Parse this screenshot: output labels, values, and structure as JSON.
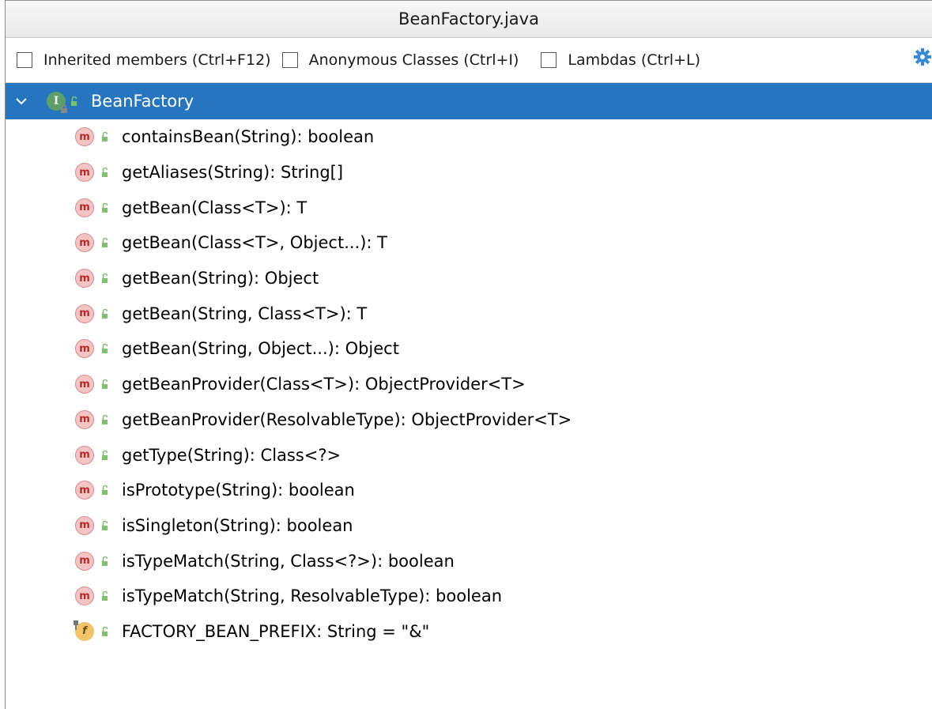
{
  "window": {
    "title": "BeanFactory.java"
  },
  "options": {
    "inherited": "Inherited members (Ctrl+F12)",
    "anonymous": "Anonymous Classes (Ctrl+I)",
    "lambdas": "Lambdas (Ctrl+L)"
  },
  "tree": {
    "root": {
      "label": "BeanFactory",
      "icon_letter": "I",
      "selected": true
    },
    "members": [
      {
        "kind": "m",
        "label": "containsBean(String): boolean"
      },
      {
        "kind": "m",
        "label": "getAliases(String): String[]"
      },
      {
        "kind": "m",
        "label": "getBean(Class<T>): T"
      },
      {
        "kind": "m",
        "label": "getBean(Class<T>, Object...): T"
      },
      {
        "kind": "m",
        "label": "getBean(String): Object"
      },
      {
        "kind": "m",
        "label": "getBean(String, Class<T>): T"
      },
      {
        "kind": "m",
        "label": "getBean(String, Object...): Object"
      },
      {
        "kind": "m",
        "label": "getBeanProvider(Class<T>): ObjectProvider<T>"
      },
      {
        "kind": "m",
        "label": "getBeanProvider(ResolvableType): ObjectProvider<T>"
      },
      {
        "kind": "m",
        "label": "getType(String): Class<?>"
      },
      {
        "kind": "m",
        "label": "isPrototype(String): boolean"
      },
      {
        "kind": "m",
        "label": "isSingleton(String): boolean"
      },
      {
        "kind": "m",
        "label": "isTypeMatch(String, Class<?>): boolean"
      },
      {
        "kind": "m",
        "label": "isTypeMatch(String, ResolvableType): boolean"
      },
      {
        "kind": "f",
        "label": "FACTORY_BEAN_PREFIX: String = \"&\""
      }
    ]
  },
  "colors": {
    "selection": "#2675bf",
    "method_icon_bg": "#f3c4c4",
    "method_icon_fg": "#b72828",
    "field_icon_bg": "#f2c46a",
    "interface_icon_bg": "#5f9e6a",
    "public_marker": "#6aa84f"
  },
  "icons": {
    "root_chevron": "chevron-down-icon",
    "settings": "gear-icon",
    "method": "method-icon",
    "field": "field-icon",
    "public": "public-access-icon"
  }
}
